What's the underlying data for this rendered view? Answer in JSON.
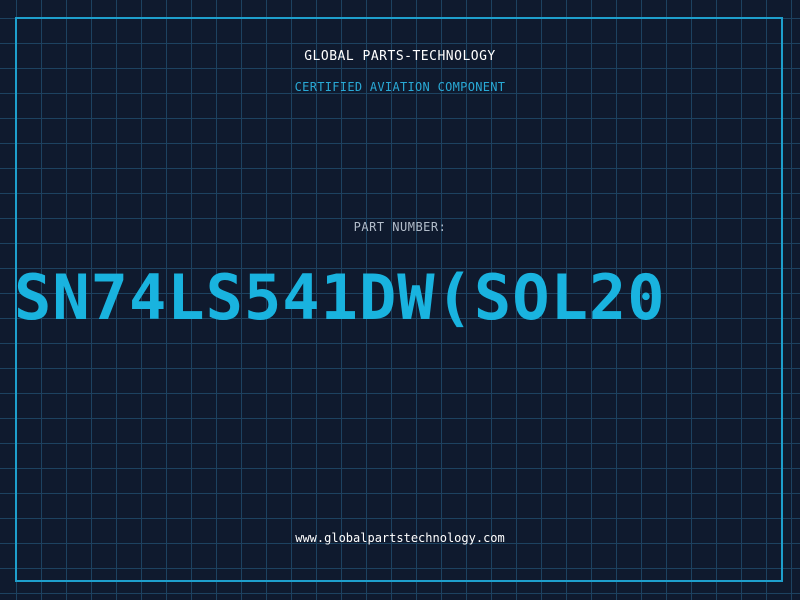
{
  "header": {
    "company_name": "GLOBAL PARTS-TECHNOLOGY",
    "tagline": "CERTIFIED AVIATION COMPONENT"
  },
  "part": {
    "label": "PART NUMBER:",
    "number": "SN74LS541DW(SOL20"
  },
  "footer": {
    "website": "www.globalpartstechnology.com"
  },
  "colors": {
    "background": "#0f1a2e",
    "grid": "#1d4260",
    "border": "#1e9fcc",
    "accent": "#19b3df",
    "label": "#b3bdca",
    "text": "#ffffff"
  }
}
